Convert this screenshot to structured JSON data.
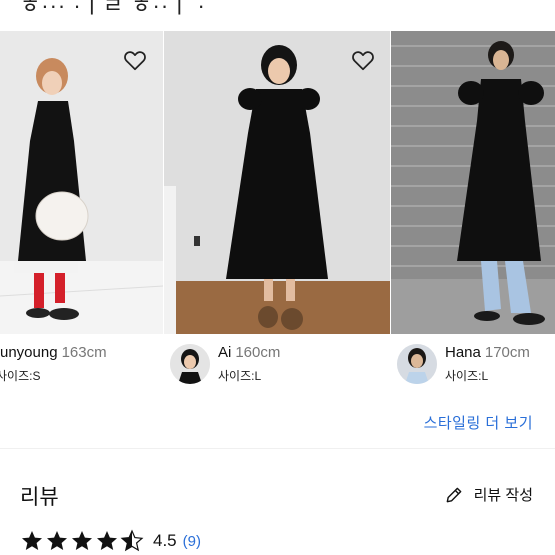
{
  "header": {
    "partial_title": "ㅎ··· ·ㅣㄹ ㅎ··ㅣ ·"
  },
  "styling_cards": [
    {
      "name": "unyoung",
      "height": "163cm",
      "size": "사이즈:S",
      "favorited": false
    },
    {
      "name": "Ai",
      "height": "160cm",
      "size": "사이즈:L",
      "favorited": false
    },
    {
      "name": "Hana",
      "height": "170cm",
      "size": "사이즈:L",
      "favorited": false
    }
  ],
  "more_styling_label": "스타일링 더 보기",
  "reviews": {
    "title": "리뷰",
    "write_label": "리뷰 작성",
    "rating": "4.5",
    "count": "(9)",
    "stars": 4.5
  },
  "colors": {
    "accent": "#2a6fd8",
    "text": "#111111",
    "muted": "#777777"
  },
  "icons": {
    "heart": "heart-outline-icon",
    "pencil": "pencil-icon",
    "star": "star-icon"
  }
}
